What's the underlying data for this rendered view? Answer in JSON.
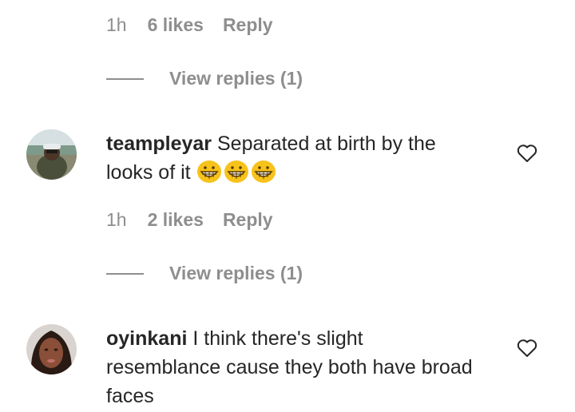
{
  "top_meta": {
    "time": "1h",
    "likes": "6 likes",
    "reply": "Reply"
  },
  "top_view_replies": "View replies (1)",
  "comments": [
    {
      "username": "teampleyar",
      "text": "Separated at birth by the looks of it",
      "emoji": [
        "grinning-face-emoji",
        "grinning-face-emoji",
        "grinning-face-emoji"
      ],
      "time": "1h",
      "likes": "2 likes",
      "reply": "Reply",
      "view_replies": "View replies (1)"
    },
    {
      "username": "oyinkani",
      "text": "I think there's slight resemblance cause they both have broad faces"
    }
  ],
  "colors": {
    "secondary_text": "#8e8e8e",
    "primary_text": "#262626",
    "emoji": "#f7c21a"
  }
}
